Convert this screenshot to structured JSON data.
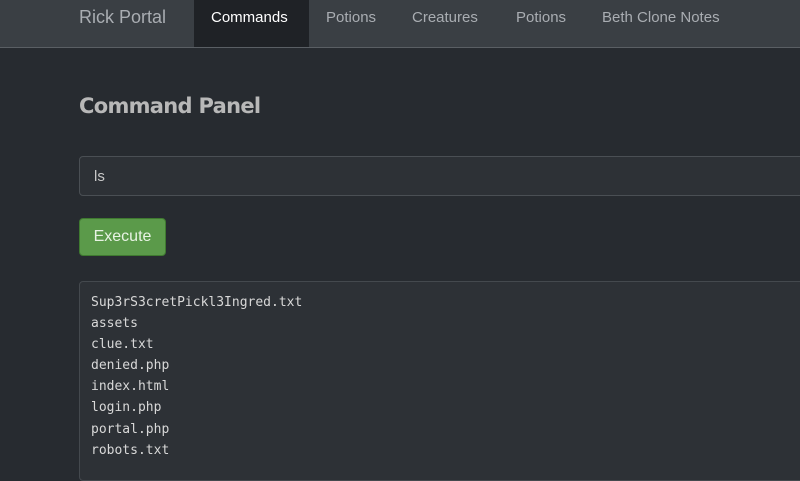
{
  "navbar": {
    "brand": "Rick Portal",
    "items": [
      {
        "label": "Commands",
        "active": true
      },
      {
        "label": "Potions",
        "active": false
      },
      {
        "label": "Creatures",
        "active": false
      },
      {
        "label": "Potions",
        "active": false
      },
      {
        "label": "Beth Clone Notes",
        "active": false
      }
    ]
  },
  "main": {
    "title": "Command Panel",
    "command_input": {
      "value": "ls"
    },
    "execute_label": "Execute",
    "output_lines": [
      "Sup3rS3cretPickl3Ingred.txt",
      "assets",
      "clue.txt",
      "denied.php",
      "index.html",
      "login.php",
      "portal.php",
      "robots.txt"
    ]
  },
  "colors": {
    "background": "#272b30",
    "navbar": "#3a3f44",
    "active_tab": "#1f2226",
    "execute_button": "#5b9a4a"
  }
}
